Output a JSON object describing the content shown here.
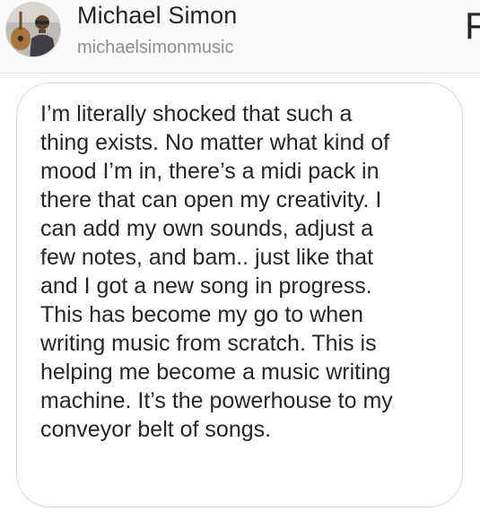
{
  "profile": {
    "name": "Michael Simon",
    "handle": "michaelsimonmusic",
    "avatar_icon": "profile-photo-with-guitar"
  },
  "header": {
    "cutoff_glyph": "F"
  },
  "message": {
    "text": "I’m literally shocked that such a\nthing exists. No matter what kind of\nmood I’m in, there’s a midi pack in\nthere that can open my creativity. I\ncan add my own sounds, adjust a\nfew notes, and bam.. just like that\nand I got a new song in progress.\nThis has become my go to when\nwriting music from scratch. This is\nhelping me become a music writing\nmachine. It’s the powerhouse to my\nconveyor belt of songs."
  },
  "colors": {
    "text_primary": "#262626",
    "text_secondary": "#8e8e8e",
    "bubble_border": "#dbdbdb",
    "header_background": "#fafafa"
  }
}
